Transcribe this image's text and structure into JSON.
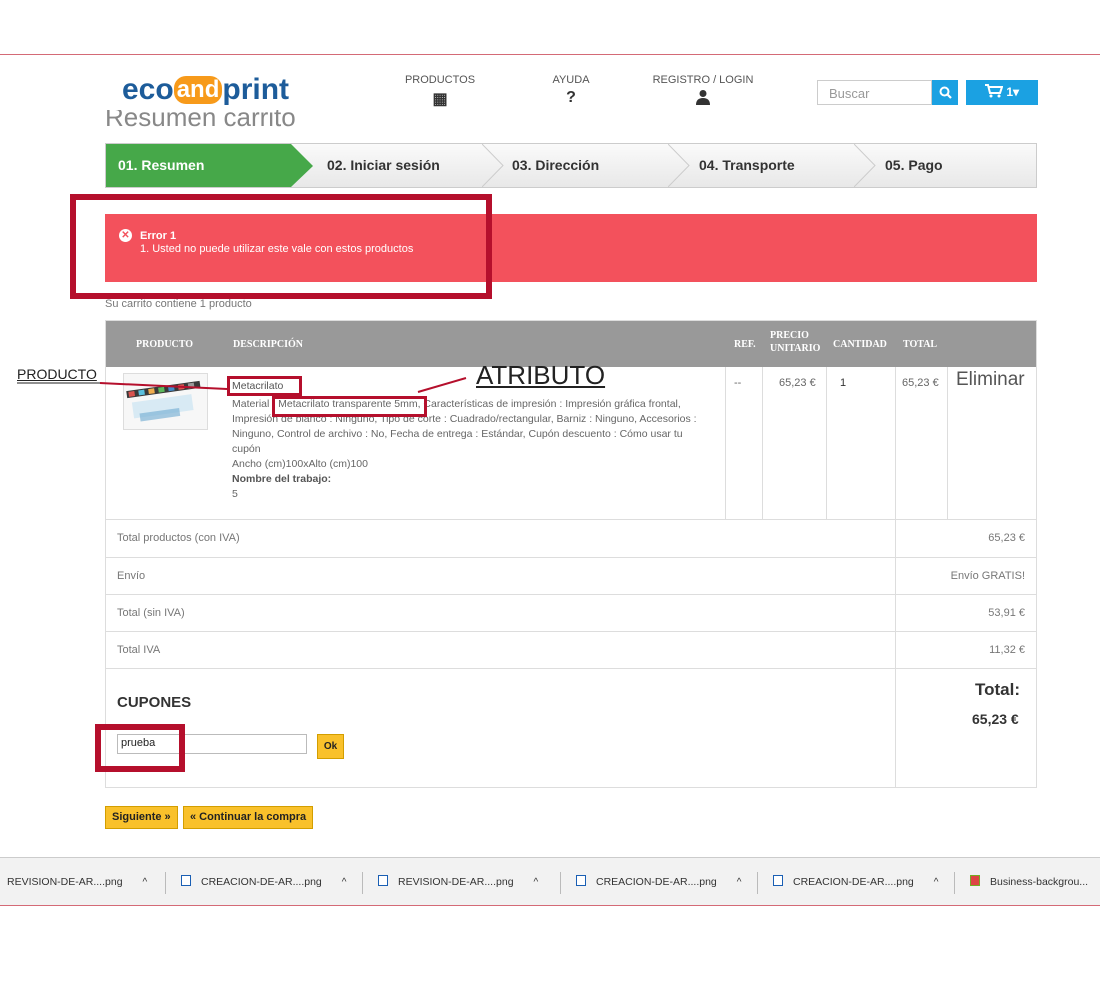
{
  "header": {
    "logo": {
      "part1": "eco",
      "part2": "and",
      "part3": "print"
    },
    "nav": [
      {
        "label": "PRODUCTOS",
        "icon": "grid-icon",
        "glyph": "▦"
      },
      {
        "label": "AYUDA",
        "icon": "question-icon",
        "glyph": "?"
      },
      {
        "label": "REGISTRO / LOGIN",
        "icon": "user-icon",
        "glyph": "👤"
      }
    ],
    "search_placeholder": "Buscar",
    "cart_label": "1"
  },
  "steps": [
    "01. Resumen",
    "02. Iniciar sesión",
    "03. Dirección",
    "04. Transporte",
    "05. Pago"
  ],
  "error": {
    "title": "Error 1",
    "message": "1. Usted no puede utilizar este vale con estos productos"
  },
  "cart_count": "Su carrito contiene 1 producto",
  "table": {
    "headers": {
      "producto": "PRODUCTO",
      "descripcion": "DESCRIPCIÓN",
      "ref": "REF.",
      "precio_1": "PRECIO",
      "precio_2": "UNITARIO",
      "cantidad": "CANTIDAD",
      "total": "TOTAL"
    },
    "item": {
      "name": "Metacrilato",
      "material_label": "Material :",
      "material_value": "Metacrilato transparente 5mm",
      "attributes": ", Características de impresión : Impresión gráfica frontal, Impresión de blanco : Ninguno, Tipo de corte : Cuadrado/rectangular, Barniz : Ninguno, Accesorios : Ninguno, Control de archivo : No, Fecha de entrega : Estándar, Cupón descuento : Cómo usar tu cupón",
      "size": "Ancho (cm)100xAlto (cm)100",
      "job_label": "Nombre del trabajo:",
      "job_value": "5",
      "ref": "--",
      "unit_price": "65,23 €",
      "quantity": "1",
      "total": "65,23 €",
      "remove_label": "Eliminar"
    },
    "summary": [
      {
        "label": "Total productos (con IVA)",
        "value": "65,23 €"
      },
      {
        "label": "Envío",
        "value": "Envío GRATIS!"
      },
      {
        "label": "Total (sin IVA)",
        "value": "53,91 €"
      },
      {
        "label": "Total IVA",
        "value": "11,32 €"
      }
    ],
    "coupons_title": "CUPONES",
    "coupon_value": "prueba",
    "ok_label": "Ok",
    "total_label": "Total:",
    "total_value": "65,23 €"
  },
  "buttons": {
    "next": "Siguiente »",
    "continue": "« Continuar la compra"
  },
  "annotations": {
    "producto": "PRODUCTO",
    "atributo": "ATRIBUTO"
  },
  "annotation_color": "#b50f2c",
  "downloads": [
    "REVISION-DE-AR....png",
    "CREACION-DE-AR....png",
    "REVISION-DE-AR....png",
    "CREACION-DE-AR....png",
    "CREACION-DE-AR....png",
    "Business-backgrou..."
  ]
}
